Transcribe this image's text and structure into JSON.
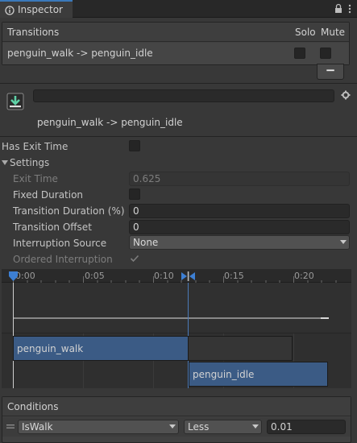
{
  "tab": {
    "title": "Inspector"
  },
  "transitions": {
    "header": "Transitions",
    "col_solo": "Solo",
    "col_mute": "Mute",
    "rows": [
      {
        "name": "penguin_walk -> penguin_idle"
      }
    ],
    "remove_label": "−"
  },
  "title_block": {
    "name_value": "",
    "subtitle": "penguin_walk -> penguin_idle"
  },
  "properties": {
    "has_exit_time": {
      "label": "Has Exit Time",
      "checked": false
    },
    "settings": {
      "label": "Settings"
    },
    "exit_time": {
      "label": "Exit Time",
      "value": "0.625"
    },
    "fixed_duration": {
      "label": "Fixed Duration",
      "checked": false
    },
    "transition_duration": {
      "label": "Transition Duration (%)",
      "value": "0"
    },
    "transition_offset": {
      "label": "Transition Offset",
      "value": "0"
    },
    "interruption_source": {
      "label": "Interruption Source",
      "value": "None"
    },
    "ordered_interruption": {
      "label": "Ordered Interruption",
      "checked": true
    }
  },
  "timeline": {
    "ticks": [
      "0:00",
      "0:05",
      "0:10",
      "0:15",
      "0:20"
    ],
    "clips": {
      "walk": "penguin_walk",
      "idle": "penguin_idle"
    }
  },
  "conditions": {
    "header": "Conditions",
    "rows": [
      {
        "parameter": "IsWalk",
        "mode": "Less",
        "value": "0.01"
      }
    ]
  },
  "colors": {
    "accent": "#3a79bb",
    "clip": "#3b5b85",
    "background": "#383838"
  },
  "icons": [
    "inspector-icon",
    "lock-icon",
    "menu-icon",
    "transition-icon",
    "gear-icon",
    "foldout-arrow-icon",
    "checkmark-icon",
    "dropdown-arrow-icon",
    "drag-handle-icon"
  ]
}
